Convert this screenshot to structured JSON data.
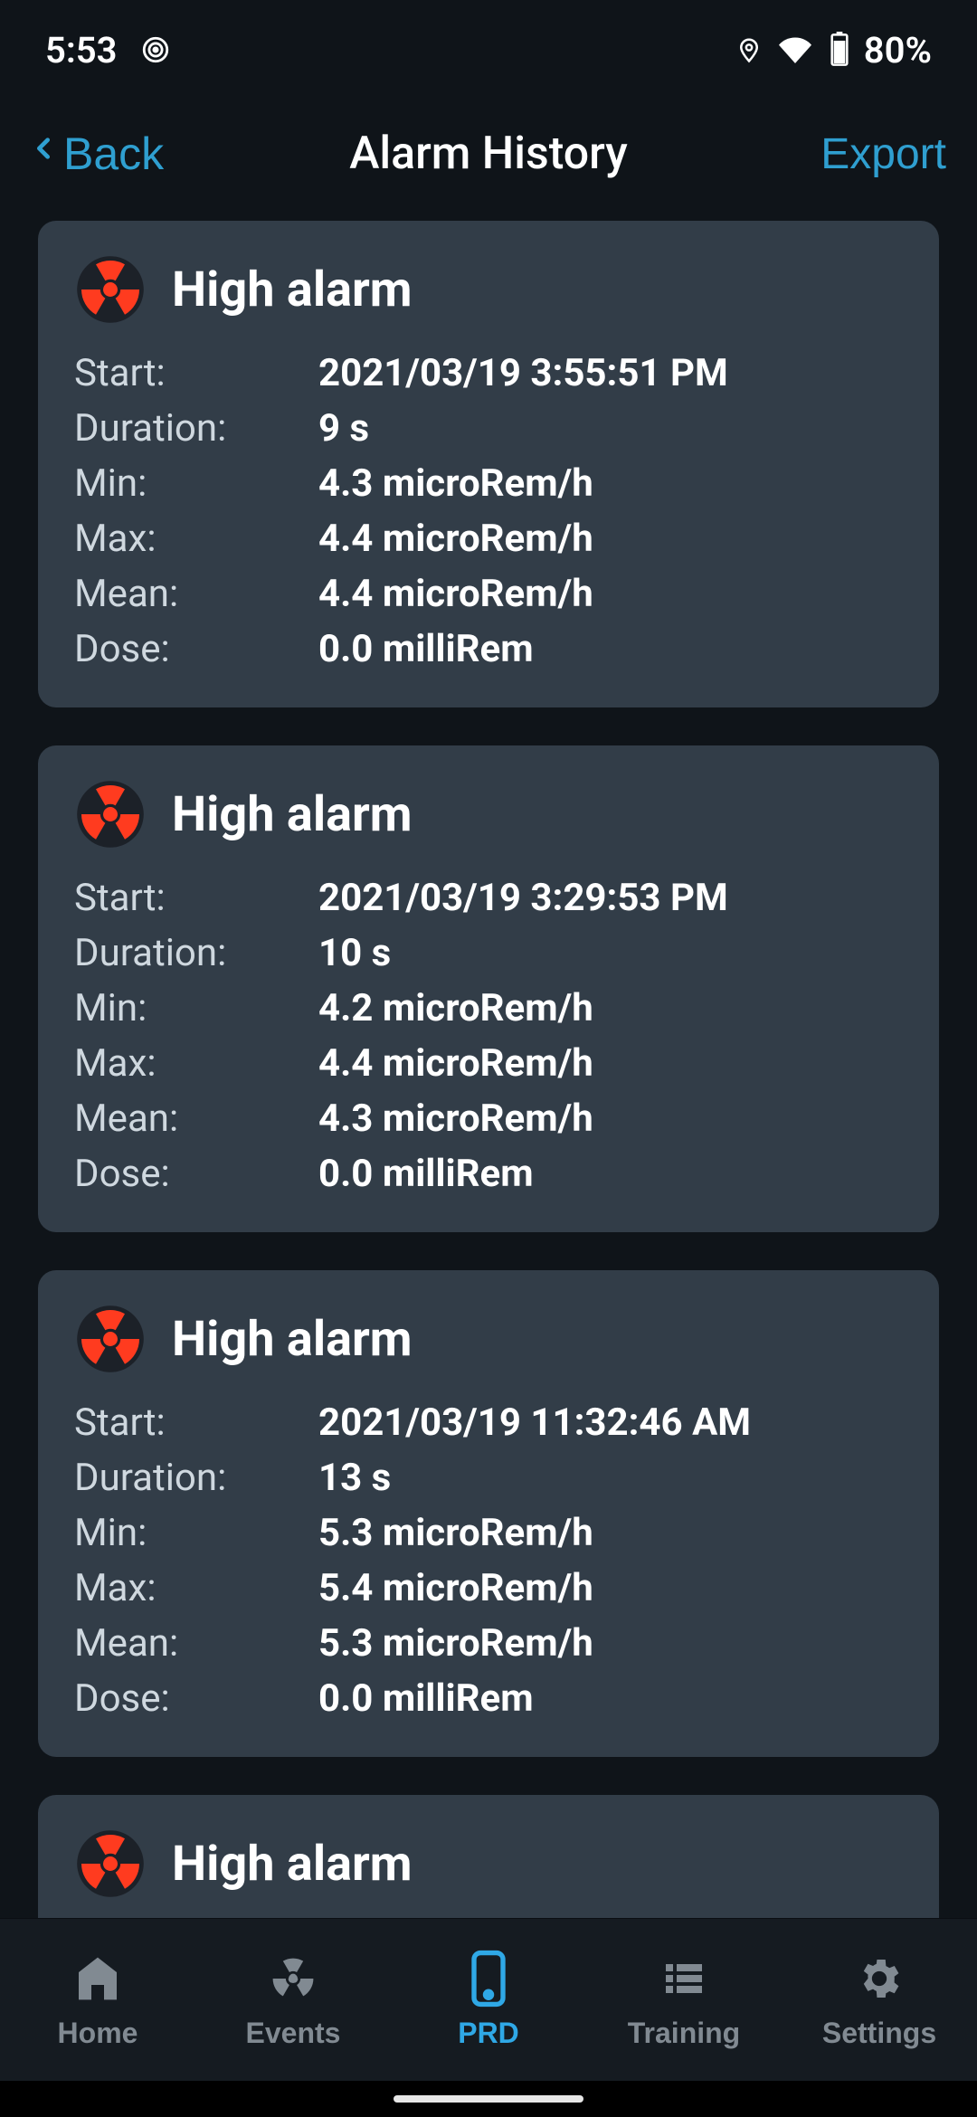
{
  "status": {
    "time": "5:53",
    "battery": "80%"
  },
  "nav": {
    "back": "Back",
    "title": "Alarm History",
    "export": "Export"
  },
  "labels": {
    "start": "Start:",
    "duration": "Duration:",
    "min": "Min:",
    "max": "Max:",
    "mean": "Mean:",
    "dose": "Dose:"
  },
  "alarms": [
    {
      "title": "High alarm",
      "start": "2021/03/19 3:55:51 PM",
      "duration": "9 s",
      "min": "4.3 microRem/h",
      "max": "4.4 microRem/h",
      "mean": "4.4 microRem/h",
      "dose": "0.0 milliRem"
    },
    {
      "title": "High alarm",
      "start": "2021/03/19 3:29:53 PM",
      "duration": "10 s",
      "min": "4.2 microRem/h",
      "max": "4.4 microRem/h",
      "mean": "4.3 microRem/h",
      "dose": "0.0 milliRem"
    },
    {
      "title": "High alarm",
      "start": "2021/03/19 11:32:46 AM",
      "duration": "13 s",
      "min": "5.3 microRem/h",
      "max": "5.4 microRem/h",
      "mean": "5.3 microRem/h",
      "dose": "0.0 milliRem"
    },
    {
      "title": "High alarm",
      "start": "",
      "duration": "",
      "min": "",
      "max": "",
      "mean": "",
      "dose": ""
    }
  ],
  "tabs": {
    "home": "Home",
    "events": "Events",
    "prd": "PRD",
    "training": "Training",
    "settings": "Settings"
  }
}
